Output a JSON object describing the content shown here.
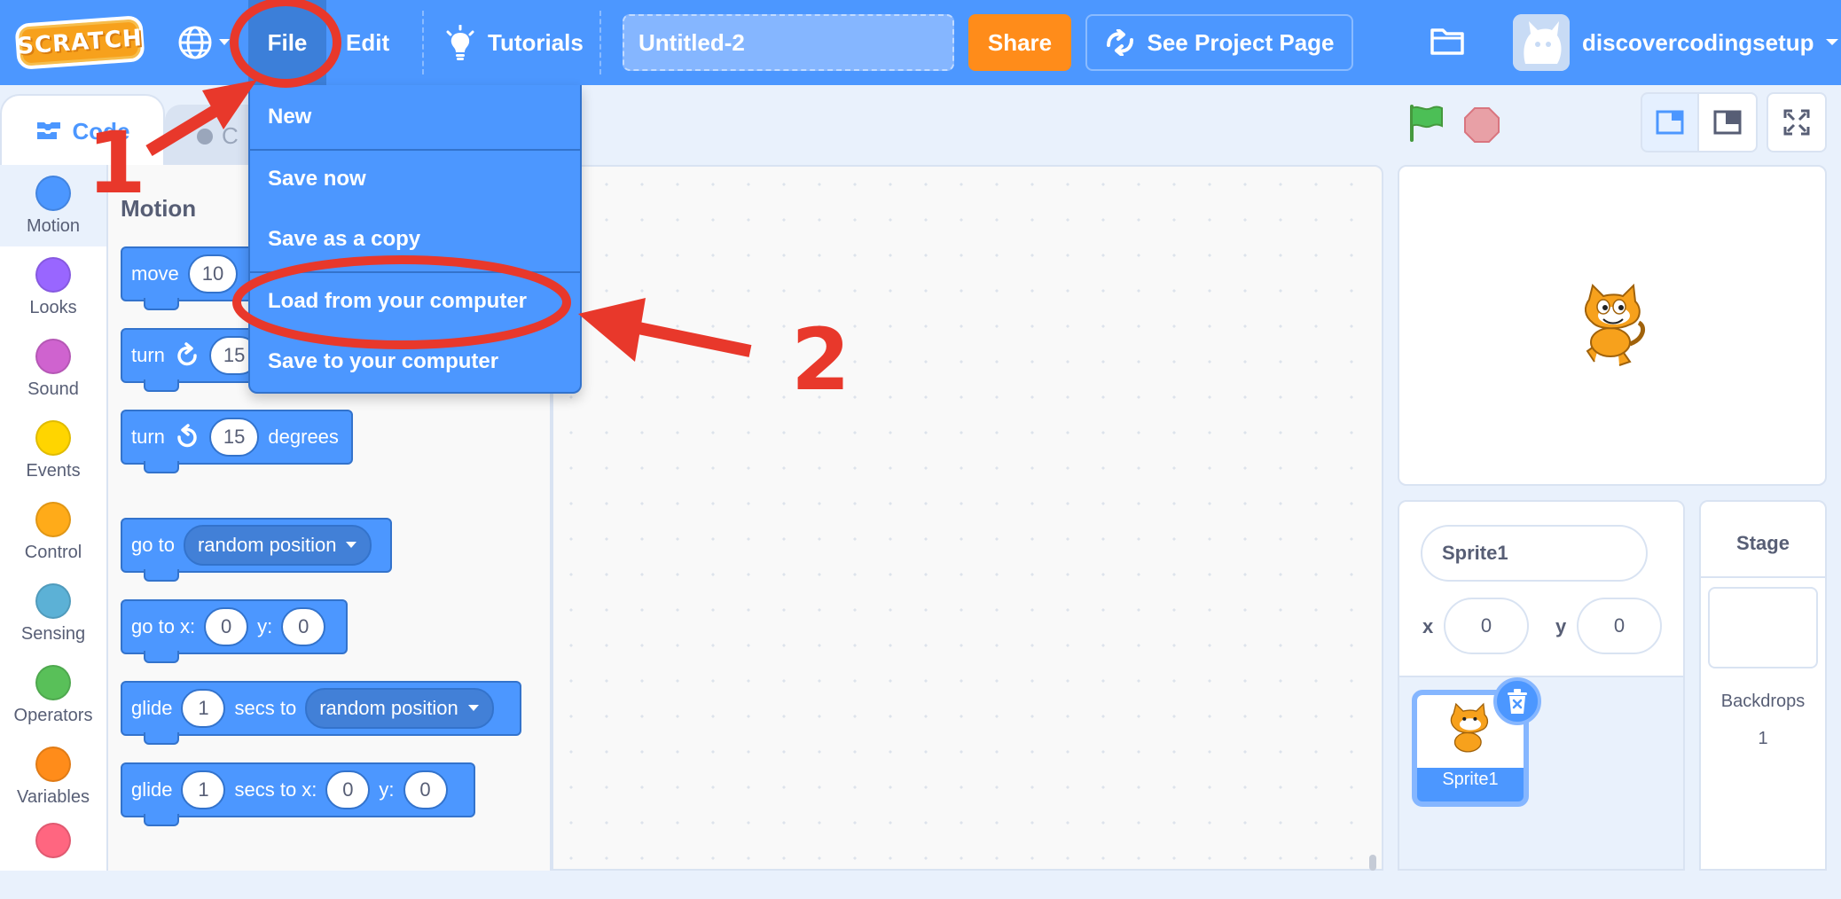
{
  "app": {
    "logo_text": "SCRATCH"
  },
  "menubar": {
    "file_label": "File",
    "edit_label": "Edit",
    "tutorials_label": "Tutorials",
    "project_title_value": "Untitled-2",
    "share_label": "Share",
    "see_project_page_label": "See Project Page",
    "username": "discovercodingsetup"
  },
  "tabs": {
    "code_label": "Code",
    "costumes_label": "C"
  },
  "categories": [
    {
      "label": "Motion",
      "color": "#4c97ff"
    },
    {
      "label": "Looks",
      "color": "#9966ff"
    },
    {
      "label": "Sound",
      "color": "#cf63cf"
    },
    {
      "label": "Events",
      "color": "#ffd500"
    },
    {
      "label": "Control",
      "color": "#ffab19"
    },
    {
      "label": "Sensing",
      "color": "#5cb1d6"
    },
    {
      "label": "Operators",
      "color": "#59c059"
    },
    {
      "label": "Variables",
      "color": "#ff8c1a"
    },
    {
      "label": "",
      "color": "#ff6680"
    }
  ],
  "palette": {
    "heading": "Motion",
    "blocks": {
      "move": {
        "label": "move",
        "steps": "10"
      },
      "turn_right": {
        "label": "turn",
        "degrees": "15"
      },
      "turn_left": {
        "label": "turn",
        "degrees": "15",
        "suffix": "degrees"
      },
      "go_to": {
        "label": "go to",
        "target": "random position"
      },
      "go_to_xy": {
        "label": "go to x:",
        "x": "0",
        "y_label": "y:",
        "y": "0"
      },
      "glide_to": {
        "label": "glide",
        "secs": "1",
        "mid": "secs to",
        "target": "random position"
      },
      "glide_xy": {
        "label": "glide",
        "secs": "1",
        "mid": "secs to x:",
        "x": "0",
        "y_label": "y:",
        "y": "0"
      }
    }
  },
  "file_menu": {
    "items": [
      "New",
      "Save now",
      "Save as a copy",
      "Load from your computer",
      "Save to your computer"
    ]
  },
  "sprite_info": {
    "name": "Sprite1",
    "x_label": "x",
    "x_value": "0",
    "y_label": "y",
    "y_value": "0",
    "sprite_tile_name": "Sprite1"
  },
  "stage_pane": {
    "heading": "Stage",
    "backdrops_label": "Backdrops",
    "backdrops_count": "1"
  },
  "annotations": {
    "step1": "1",
    "step2": "2"
  },
  "colors": {
    "accent": "#4c97ff",
    "menu_active": "#3c7fd9",
    "share": "#ff8c1a",
    "annotation": "#e8382b"
  }
}
